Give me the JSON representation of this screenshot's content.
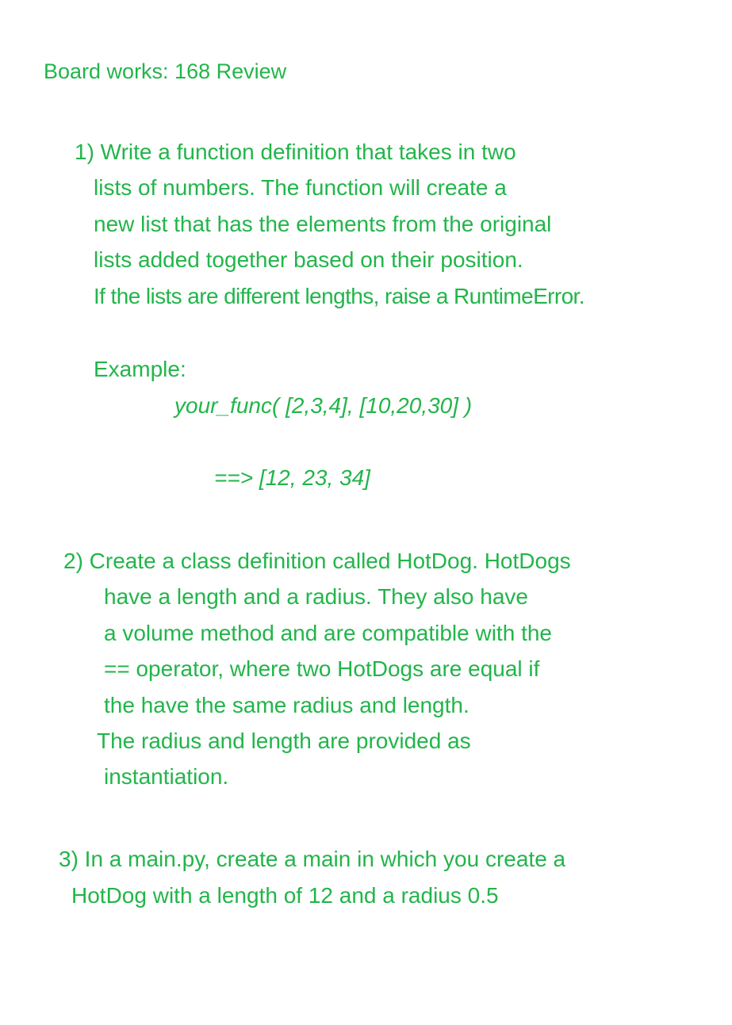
{
  "title": "Board works: 168 Review",
  "q1": {
    "lines": [
      "1) Write a function definition that takes in two",
      "lists of numbers. The function will create a",
      "new list that has the elements from the original",
      "lists added together based on their position.",
      "If the lists are different lengths, raise a RuntimeError."
    ],
    "example_label": "Example:",
    "example_call": "your_func( [2,3,4], [10,20,30] )",
    "example_result": "==> [12, 23, 34]"
  },
  "q2": {
    "lines": [
      "2) Create a class definition called HotDog. HotDogs",
      "have a length and a radius. They also have",
      "a volume method and are compatible with the",
      "== operator, where two HotDogs are equal if",
      "the have the same radius and length.",
      "The radius and length are provided as",
      "instantiation."
    ]
  },
  "q3": {
    "lines": [
      "3) In a main.py, create a main in which you create a",
      "HotDog with a length of 12 and a radius 0.5"
    ]
  },
  "colors": {
    "text": "#22b54a",
    "background": "#ffffff"
  }
}
